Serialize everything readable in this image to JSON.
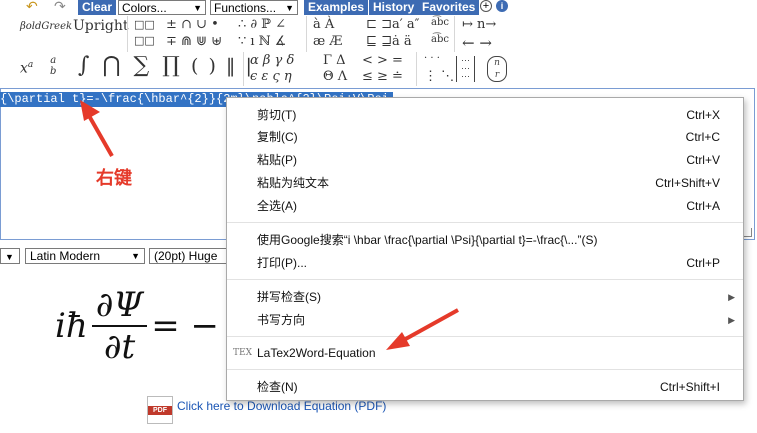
{
  "toolbar": {
    "clear_label": "Clear",
    "colors_value": "Colors...",
    "functions_value": "Functions...",
    "examples_label": "Examples",
    "history_label": "History",
    "favorites_label": "Favorites",
    "bold_greek_label": "βoldGreek",
    "upright_label": "Upright",
    "row1_symbols": "± ∩ ∪ •",
    "row2_symbols": "∓ ⋒ ⋓ ⊎",
    "row1_symbols2": "∴ ∂ ℙ ∠",
    "row2_symbols2": "∵ ı ℕ ∡",
    "row1_accents": "à À",
    "row2_accents": "æ Æ",
    "row1_subset": "⊏ ⊐",
    "row2_subset": "⊑ ⊒",
    "row1_primes": "a′ a″",
    "row2_primes": "ȧ ä",
    "arrows_row1": "↦ n→",
    "arrows_row2": "← →",
    "big_row": "∫ ⋂ ∑ ∏",
    "delims": "( ) ‖ |",
    "greek_row1": "α β γ δ",
    "greek_row2": "ϵ ε ς η",
    "greek_upper1": "Γ Δ",
    "greek_upper2": "Θ Λ",
    "rel_row1": "< > =",
    "rel_row2": "≤ ≥ ≐",
    "dots_row1": "· · ·",
    "dots_row2": "⋮ ⋱"
  },
  "editor": {
    "selected_text": "{\\partial t}=-\\frac{\\hbar^{2}}{2m}\\nabla^{2}\\Psi+V\\Psi"
  },
  "format_bar": {
    "font_value": "Latin Modern",
    "size_value": "(20pt) Huge"
  },
  "equation": {
    "lhs": "iħ",
    "num": "∂Ψ",
    "den": "∂t",
    "rhs": "= −"
  },
  "pdf": {
    "icon_text": "PDF",
    "link_text": "Click here to Download Equation (PDF)"
  },
  "annotation": "右键",
  "context_menu": {
    "items": [
      {
        "label": "剪切(T)",
        "shortcut": "Ctrl+X"
      },
      {
        "label": "复制(C)",
        "shortcut": "Ctrl+C"
      },
      {
        "label": "粘贴(P)",
        "shortcut": "Ctrl+V"
      },
      {
        "label": "粘贴为纯文本",
        "shortcut": "Ctrl+Shift+V"
      },
      {
        "label": "全选(A)",
        "shortcut": "Ctrl+A"
      },
      {
        "label": "使用Google搜索“i \\hbar \\frac{\\partial \\Psi}{\\partial t}=-\\frac{\\...”(S)",
        "shortcut": ""
      },
      {
        "label": "打印(P)...",
        "shortcut": "Ctrl+P"
      },
      {
        "label": "拼写检查(S)",
        "shortcut": ""
      },
      {
        "label": "书写方向",
        "shortcut": ""
      },
      {
        "label": "LaTex2Word-Equation",
        "shortcut": "",
        "icon": "TEX"
      },
      {
        "label": "检查(N)",
        "shortcut": "Ctrl+Shift+I"
      }
    ]
  },
  "colors": {
    "accent": "#3d6bb3",
    "selection": "#3373c4",
    "annotation_red": "#e53a2a"
  }
}
